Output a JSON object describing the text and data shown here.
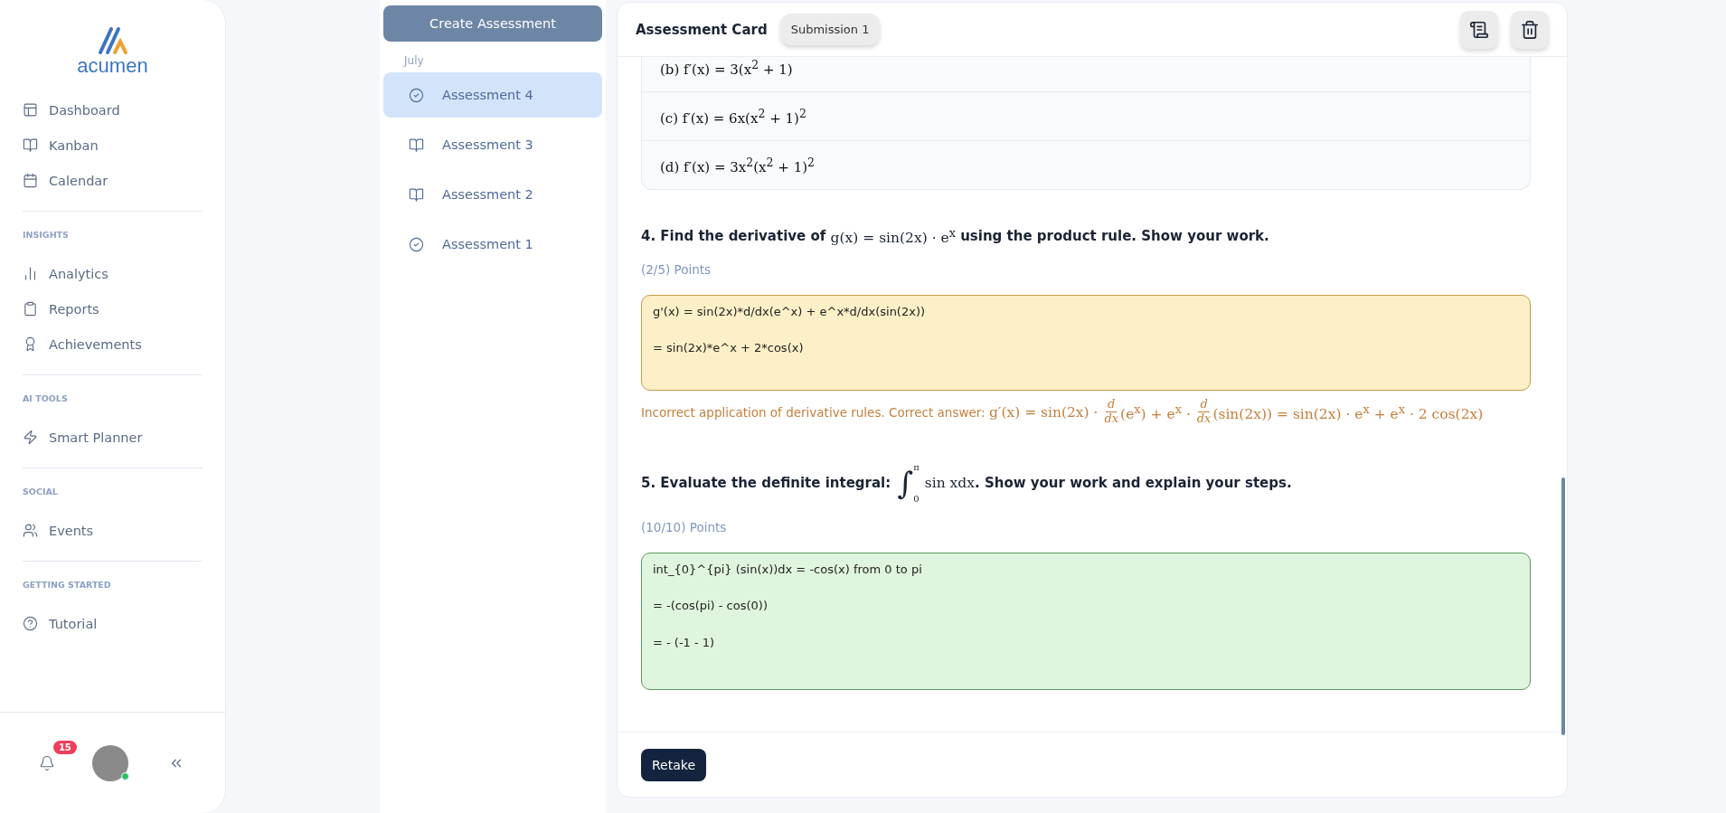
{
  "sidebar": {
    "logo_text": "acumen",
    "sections": [
      {
        "items": [
          {
            "label": "Dashboard",
            "kind": "dashboard"
          },
          {
            "label": "Kanban",
            "kind": "book"
          },
          {
            "label": "Calendar",
            "kind": "calendar"
          }
        ]
      },
      {
        "title": "INSIGHTS",
        "items": [
          {
            "label": "Analytics",
            "kind": "chart"
          },
          {
            "label": "Reports",
            "kind": "clipboard"
          },
          {
            "label": "Achievements",
            "kind": "award"
          }
        ]
      },
      {
        "title": "AI TOOLS",
        "items": [
          {
            "label": "Smart Planner",
            "kind": "zap"
          }
        ]
      },
      {
        "title": "SOCIAL",
        "items": [
          {
            "label": "Events",
            "kind": "users"
          }
        ]
      },
      {
        "title": "GETTING STARTED",
        "items": [
          {
            "label": "Tutorial",
            "kind": "help"
          }
        ]
      }
    ],
    "notification_count": "15",
    "user_online": true
  },
  "assessments": {
    "create_button": "Create Assessment",
    "group": "July",
    "items": [
      {
        "label": "Assessment 4",
        "kind": "done",
        "selected": true
      },
      {
        "label": "Assessment 3",
        "kind": "open",
        "selected": false
      },
      {
        "label": "Assessment 2",
        "kind": "open",
        "selected": false
      },
      {
        "label": "Assessment 1",
        "kind": "done",
        "selected": false
      }
    ]
  },
  "card": {
    "title": "Assessment Card",
    "submission": "Submission 1",
    "options": [
      "(b) f′(x) = 3(x$^{2}$ + 1)",
      "(c) f′(x) = 6x(x$^{2}$ + 1)$^{2}$",
      "(d) f′(x) = 3x$^{2}$(x$^{2}$ + 1)$^{2}$"
    ],
    "questions": [
      {
        "segments": [
          {
            "kind": "text",
            "text": "4. Find the derivative of "
          },
          {
            "kind": "math",
            "text": "g(x) = sin(2x) · e$^{x}$"
          },
          {
            "kind": "text",
            "text": " using the product rule. Show your work."
          }
        ],
        "points": "(2/5) Points",
        "kind": "partial",
        "answer": [
          "g'(x) = sin(2x)*d/dx(e^x) + e^x*d/dx(sin(2x))",
          "= sin(2x)*e^x + 2*cos(x)"
        ],
        "feedback": [
          {
            "kind": "text",
            "text": "Incorrect application of derivative rules. Correct answer: "
          },
          {
            "kind": "math",
            "text": "g′(x) = sin(2x) · "
          },
          {
            "kind": "frac",
            "num": "d",
            "den": "dx"
          },
          {
            "kind": "math",
            "text": "(e$^{x}$) + e$^{x}$ · "
          },
          {
            "kind": "frac",
            "num": "d",
            "den": "dx"
          },
          {
            "kind": "math",
            "text": "(sin(2x)) = sin(2x) · e$^{x}$ + e$^{x}$ · 2 cos(2x)"
          }
        ]
      },
      {
        "segments": [
          {
            "kind": "text",
            "text": "5. Evaluate the definite integral: "
          },
          {
            "kind": "integral",
            "sign": "∫",
            "lower": "0",
            "upper": "π"
          },
          {
            "kind": "math",
            "text": "sin xdx"
          },
          {
            "kind": "text",
            "text": ". Show your work and explain your steps."
          }
        ],
        "points": "(10/10) Points",
        "kind": "correct",
        "answer": [
          "int_{0}^{pi} (sin(x))dx = -cos(x) from 0 to pi",
          "= -(cos(pi) - cos(0))",
          "= - (-1 - 1)"
        ]
      }
    ],
    "retake_button": "Retake"
  }
}
